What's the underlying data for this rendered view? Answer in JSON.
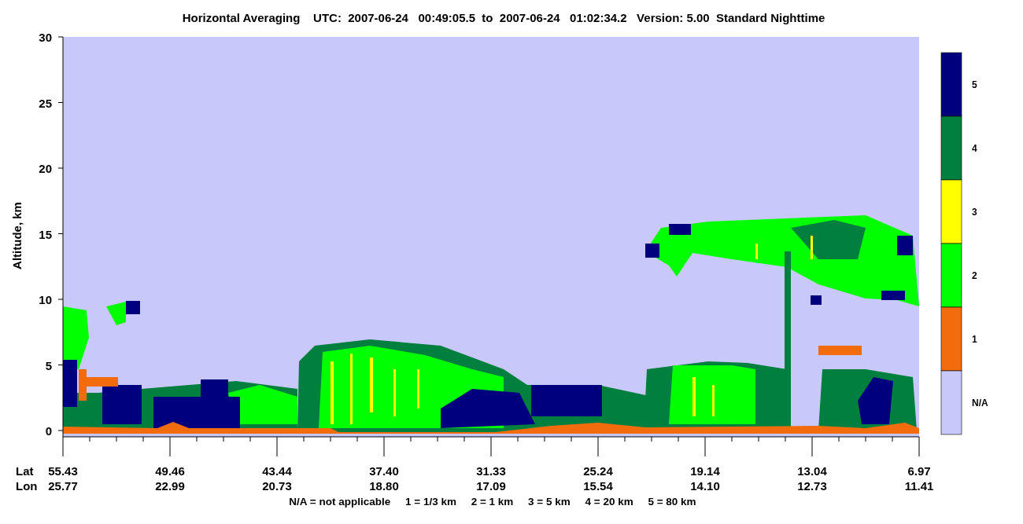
{
  "title": "Horizontal Averaging    UTC:  2007-06-24   00:49:05.5  to  2007-06-24   01:02:34.2   Version: 5.00  Standard Nighttime",
  "y_axis": {
    "label": "Altitude, km",
    "ticks": [
      "30",
      "25",
      "20",
      "15",
      "10",
      "5",
      "0"
    ]
  },
  "x_axis": {
    "row_labels": [
      "Lat",
      "Lon"
    ],
    "ticks": [
      {
        "lat": "55.43",
        "lon": "25.77"
      },
      {
        "lat": "49.46",
        "lon": "22.99"
      },
      {
        "lat": "43.44",
        "lon": "20.73"
      },
      {
        "lat": "37.40",
        "lon": "18.80"
      },
      {
        "lat": "31.33",
        "lon": "17.09"
      },
      {
        "lat": "25.24",
        "lon": "15.54"
      },
      {
        "lat": "19.14",
        "lon": "14.10"
      },
      {
        "lat": "13.04",
        "lon": "12.73"
      },
      {
        "lat": "6.97",
        "lon": "11.41"
      }
    ]
  },
  "legend": [
    {
      "label": "5",
      "color": "#00007f"
    },
    {
      "label": "4",
      "color": "#007f3f"
    },
    {
      "label": "3",
      "color": "#ffff00"
    },
    {
      "label": "2",
      "color": "#00ff00"
    },
    {
      "label": "1",
      "color": "#f26b0c"
    },
    {
      "label": "N/A",
      "color": "#c8c8fa"
    }
  ],
  "footnote": "N/A = not applicable     1 = 1/3 km     2 = 1 km     3 = 5 km     4 = 20 km     5 = 80 km"
}
